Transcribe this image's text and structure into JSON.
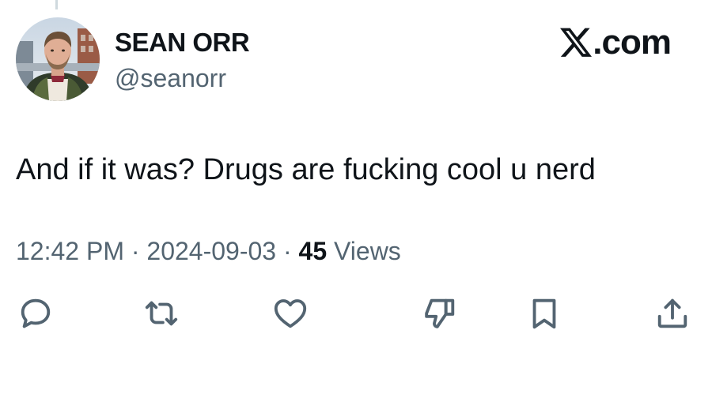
{
  "author": {
    "display_name": "SEAN ORR",
    "handle": "@seanorr"
  },
  "brand": {
    "label": ".com",
    "icon": "x-logo-icon"
  },
  "tweet": {
    "text": "And if it was? Drugs are fucking cool u nerd",
    "time": "12:42 PM",
    "separator": "·",
    "date": "2024-09-03",
    "views_count": "45",
    "views_label": "Views"
  },
  "actions": [
    {
      "name": "reply",
      "icon": "reply-bubble-icon"
    },
    {
      "name": "repost",
      "icon": "repost-arrows-icon"
    },
    {
      "name": "like",
      "icon": "heart-icon"
    },
    {
      "name": "dislike",
      "icon": "thumbs-down-icon"
    },
    {
      "name": "bookmark",
      "icon": "bookmark-icon"
    },
    {
      "name": "share",
      "icon": "share-upload-icon"
    }
  ],
  "colors": {
    "text_primary": "#0f1419",
    "text_secondary": "#536471",
    "icon": "#536471",
    "thread_line": "#cfd9de"
  }
}
